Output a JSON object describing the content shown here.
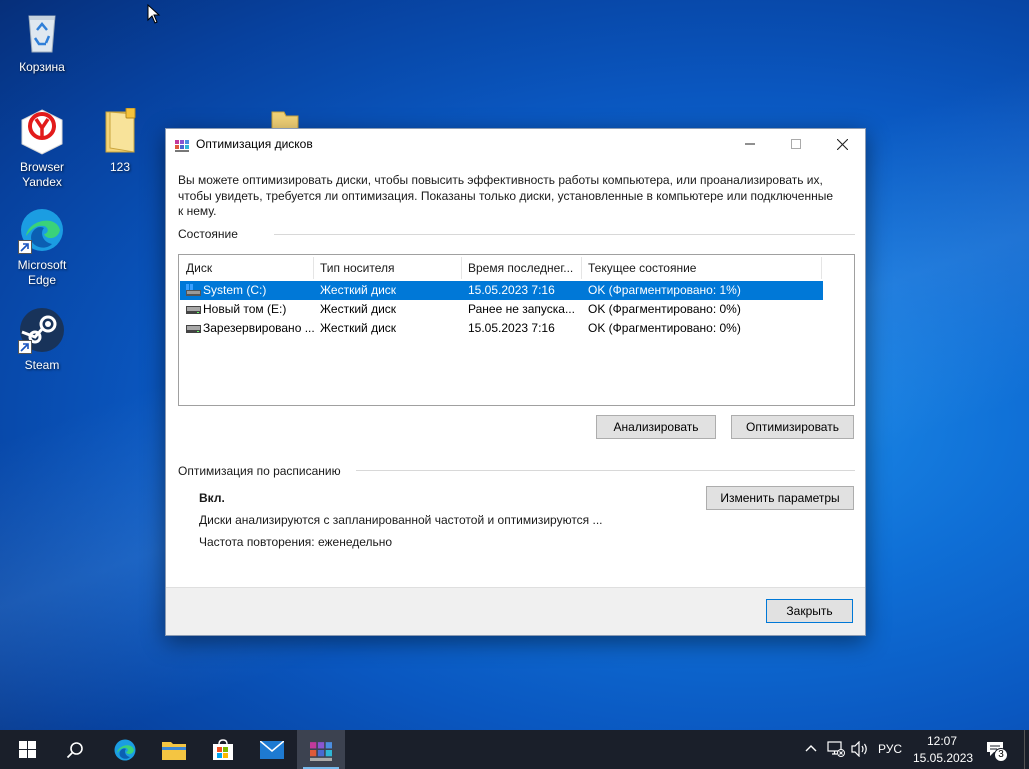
{
  "desktop": {
    "icons": [
      {
        "label": "Корзина"
      },
      {
        "label": "Browser Yandex"
      },
      {
        "label": "123"
      },
      {
        "label": "Microsoft Edge"
      },
      {
        "label": "Steam"
      }
    ]
  },
  "window": {
    "title": "Оптимизация дисков",
    "intro": "Вы можете оптимизировать диски, чтобы повысить эффективность работы  компьютера, или проанализировать их, чтобы увидеть, требуется ли оптимизация. Показаны только диски, установленные в компьютере или подключенные к нему.",
    "status_label": "Состояние",
    "columns": [
      "Диск",
      "Тип носителя",
      "Время последнег...",
      "Текущее состояние"
    ],
    "rows": [
      {
        "disk": "System (C:)",
        "media": "Жесткий диск",
        "last": "15.05.2023 7:16",
        "state": "OK (Фрагментировано: 1%)",
        "selected": true,
        "icon": "system-drive-icon"
      },
      {
        "disk": "Новый том (E:)",
        "media": "Жесткий диск",
        "last": "Ранее не запуска...",
        "state": "OK (Фрагментировано: 0%)",
        "selected": false,
        "icon": "hard-drive-icon"
      },
      {
        "disk": "Зарезервировано ...",
        "media": "Жесткий диск",
        "last": "15.05.2023 7:16",
        "state": "OK (Фрагментировано: 0%)",
        "selected": false,
        "icon": "hard-drive-icon"
      }
    ],
    "analyze_label": "Анализировать",
    "optimize_label": "Оптимизировать",
    "schedule_label": "Оптимизация по расписанию",
    "schedule_on": "Вкл.",
    "schedule_desc": "Диски анализируются с запланированной частотой и оптимизируются ...",
    "schedule_freq": "Частота повторения: еженедельно",
    "change_label": "Изменить параметры",
    "close_label": "Закрыть"
  },
  "taskbar": {
    "lang": "РУС",
    "time": "12:07",
    "date": "15.05.2023",
    "notifications": "3"
  },
  "colors": {
    "selection": "#0078d7",
    "taskbar": "#1a1f2a"
  }
}
